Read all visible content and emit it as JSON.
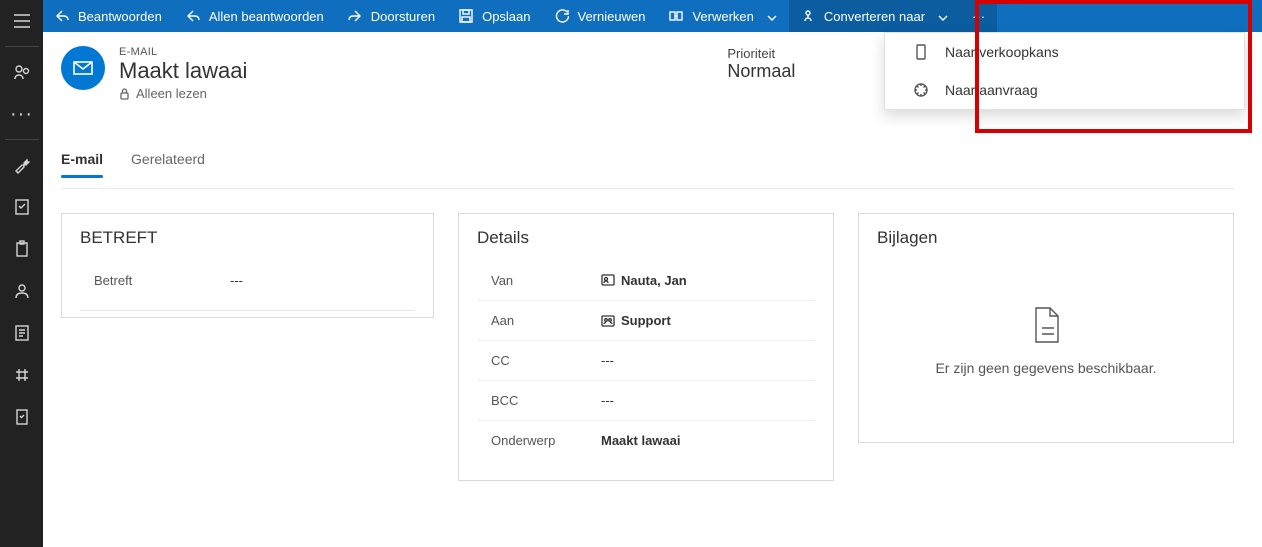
{
  "cmdbar": {
    "reply": "Beantwoorden",
    "reply_all": "Allen beantwoorden",
    "forward": "Doorsturen",
    "save": "Opslaan",
    "refresh": "Vernieuwen",
    "process": "Verwerken",
    "convert": "Converteren naar"
  },
  "dropdown": {
    "to_opportunity": "Naar verkoopkans",
    "to_case": "Naar aanvraag"
  },
  "header": {
    "overline": "E-MAIL",
    "title": "Maakt lawaai",
    "readonly": "Alleen lezen",
    "priority_label": "Prioriteit",
    "priority_value": "Normaal"
  },
  "tabs": {
    "email": "E-mail",
    "related": "Gerelateerd"
  },
  "cards": {
    "betreft": {
      "title": "BETREFT",
      "label": "Betreft",
      "value": "---"
    },
    "details": {
      "title": "Details",
      "from_label": "Van",
      "from_value": "Nauta, Jan",
      "to_label": "Aan",
      "to_value": "Support",
      "cc_label": "CC",
      "cc_value": "---",
      "bcc_label": "BCC",
      "bcc_value": "---",
      "subject_label": "Onderwerp",
      "subject_value": "Maakt lawaai"
    },
    "bijlagen": {
      "title": "Bijlagen",
      "empty": "Er zijn geen gegevens beschikbaar."
    }
  }
}
